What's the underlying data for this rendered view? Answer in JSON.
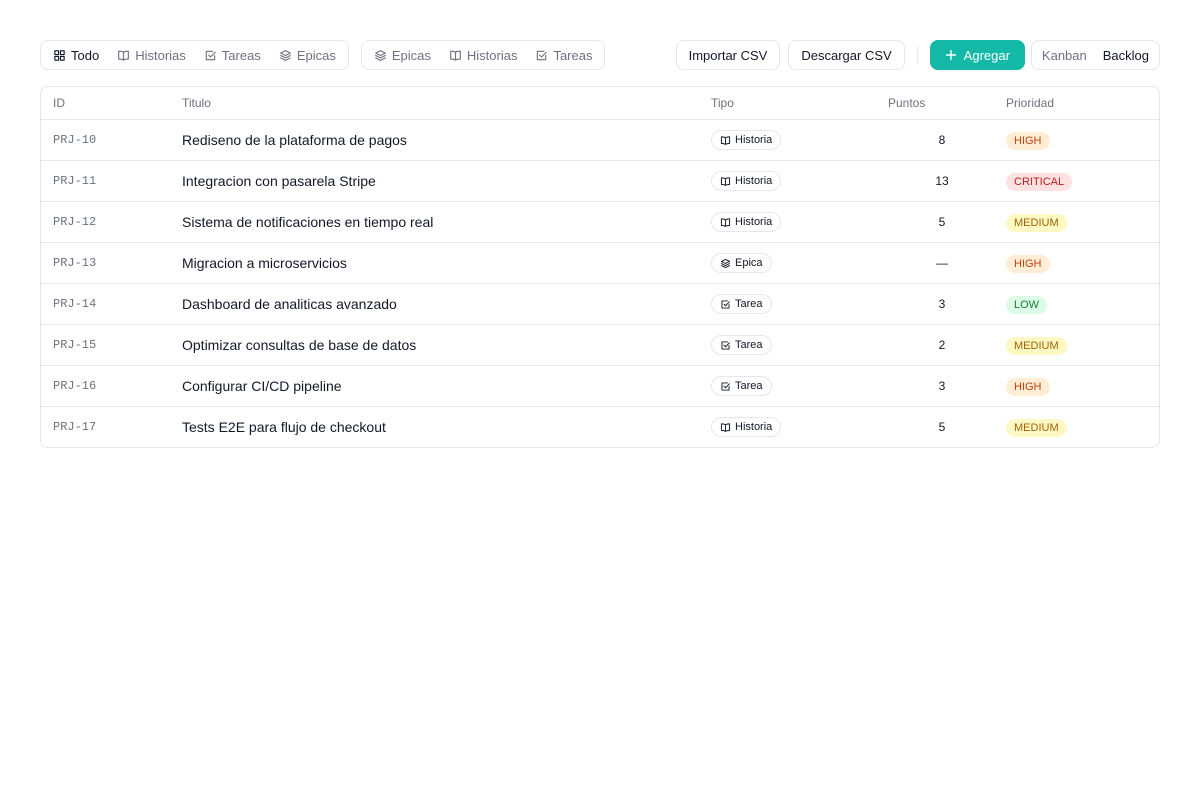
{
  "filters_primary": [
    {
      "label": "Todo",
      "icon": "grid-icon",
      "active": true
    },
    {
      "label": "Historias",
      "icon": "book-icon",
      "active": false
    },
    {
      "label": "Tareas",
      "icon": "checkbox-icon",
      "active": false
    },
    {
      "label": "Epicas",
      "icon": "layers-icon",
      "active": false
    }
  ],
  "filters_secondary": [
    {
      "label": "Epicas",
      "icon": "layers-icon"
    },
    {
      "label": "Historias",
      "icon": "book-icon"
    },
    {
      "label": "Tareas",
      "icon": "checkbox-icon"
    }
  ],
  "actions": {
    "import_label": "Importar CSV",
    "download_label": "Descargar CSV",
    "add_label": "Agregar"
  },
  "views": {
    "kanban_label": "Kanban",
    "backlog_label": "Backlog",
    "active": "Backlog"
  },
  "colors": {
    "accent": "#14b8a6",
    "border": "#e5e7eb",
    "muted_text": "#6b7280",
    "priority_high": "#ffedd5",
    "priority_critical": "#fee2e2",
    "priority_medium": "#fef9c3",
    "priority_low": "#dcfce7"
  },
  "table": {
    "headers": {
      "id": "ID",
      "title": "Titulo",
      "type": "Tipo",
      "points": "Puntos",
      "priority": "Prioridad"
    },
    "rows": [
      {
        "id": "PRJ-10",
        "title": "Rediseno de la plataforma de pagos",
        "type": "Historia",
        "type_icon": "book-icon",
        "points": "8",
        "priority": "HIGH"
      },
      {
        "id": "PRJ-11",
        "title": "Integracion con pasarela Stripe",
        "type": "Historia",
        "type_icon": "book-icon",
        "points": "13",
        "priority": "CRITICAL"
      },
      {
        "id": "PRJ-12",
        "title": "Sistema de notificaciones en tiempo real",
        "type": "Historia",
        "type_icon": "book-icon",
        "points": "5",
        "priority": "MEDIUM"
      },
      {
        "id": "PRJ-13",
        "title": "Migracion a microservicios",
        "type": "Epica",
        "type_icon": "layers-icon",
        "points": "—",
        "priority": "HIGH"
      },
      {
        "id": "PRJ-14",
        "title": "Dashboard de analiticas avanzado",
        "type": "Tarea",
        "type_icon": "checkbox-icon",
        "points": "3",
        "priority": "LOW"
      },
      {
        "id": "PRJ-15",
        "title": "Optimizar consultas de base de datos",
        "type": "Tarea",
        "type_icon": "checkbox-icon",
        "points": "2",
        "priority": "MEDIUM"
      },
      {
        "id": "PRJ-16",
        "title": "Configurar CI/CD pipeline",
        "type": "Tarea",
        "type_icon": "checkbox-icon",
        "points": "3",
        "priority": "HIGH"
      },
      {
        "id": "PRJ-17",
        "title": "Tests E2E para flujo de checkout",
        "type": "Historia",
        "type_icon": "book-icon",
        "points": "5",
        "priority": "MEDIUM"
      }
    ]
  }
}
